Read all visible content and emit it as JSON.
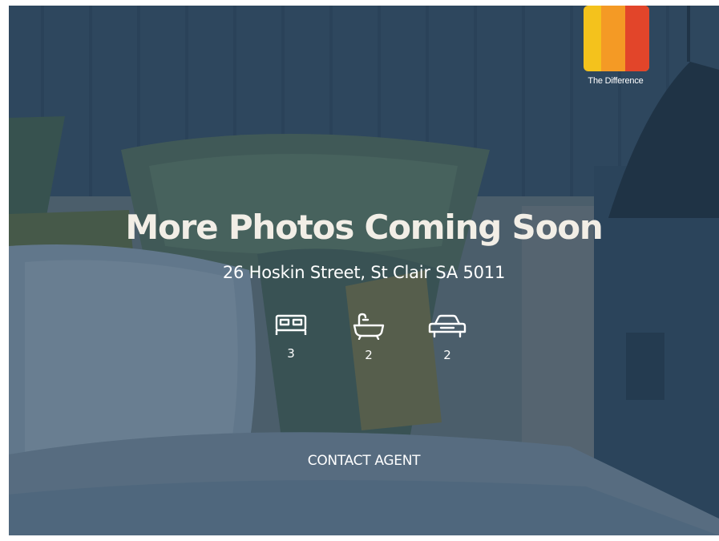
{
  "brand": {
    "name": "The Difference",
    "colors": [
      "#f4c21c",
      "#f49a25",
      "#e2452a",
      "#c9262c"
    ]
  },
  "listing": {
    "title": "More Photos Coming Soon",
    "address": "26 Hoskin Street, St Clair SA 5011"
  },
  "features": [
    {
      "icon": "bed-icon",
      "count": "3"
    },
    {
      "icon": "bath-icon",
      "count": "2"
    },
    {
      "icon": "car-icon",
      "count": "2"
    }
  ],
  "actions": {
    "contact_label": "CONTACT AGENT"
  }
}
